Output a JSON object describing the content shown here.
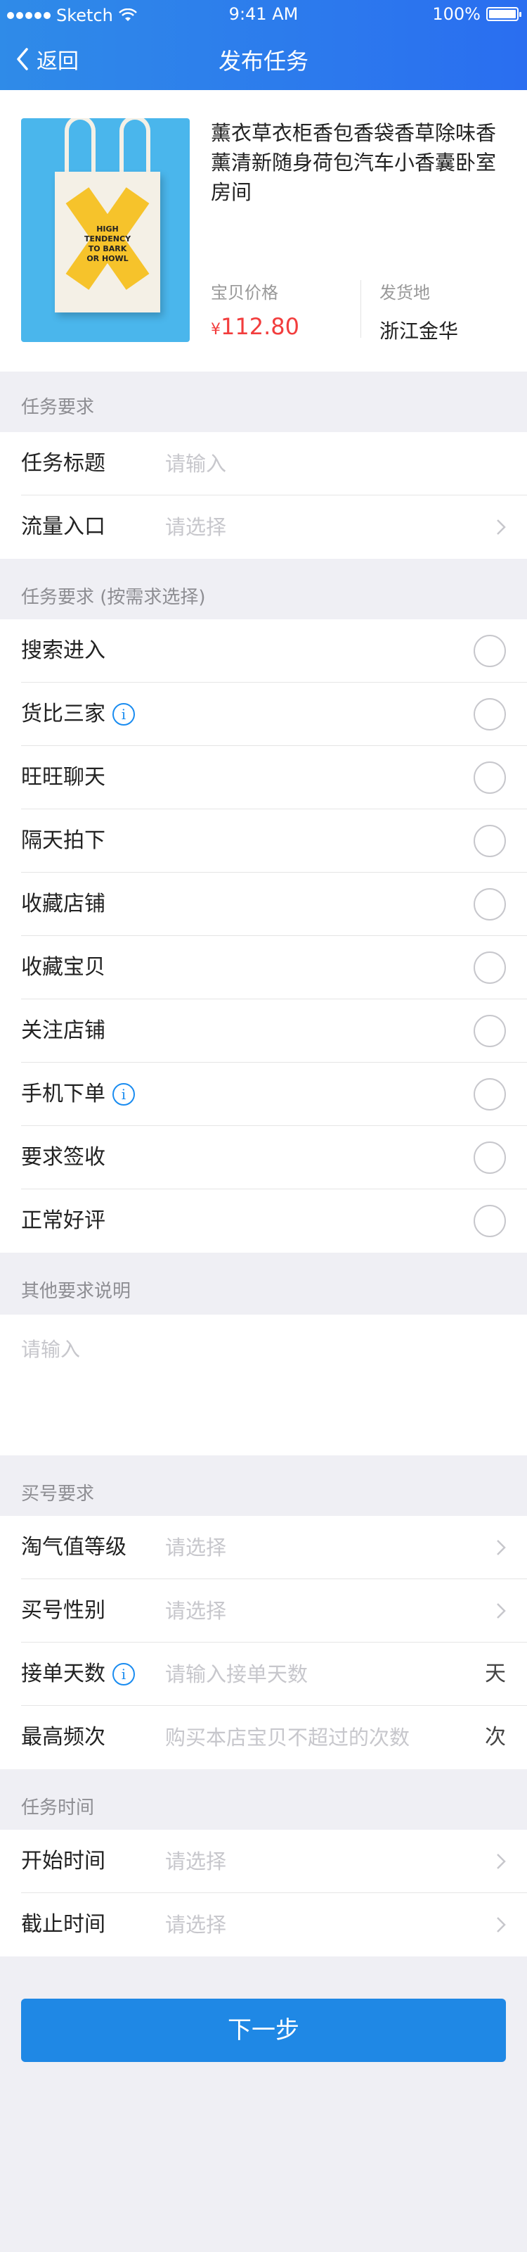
{
  "status_bar": {
    "carrier": "Sketch",
    "time": "9:41 AM",
    "battery": "100%",
    "battery_level": 1.0
  },
  "nav": {
    "back_label": "返回",
    "title": "发布任务"
  },
  "product": {
    "title": "薰衣草衣柜香包香袋香草除味香薰清新随身荷包汽车小香囊卧室房间",
    "image_text": [
      "HIGH",
      "TENDENCY",
      "TO BARK",
      "OR HOWL"
    ],
    "price_label": "宝贝价格",
    "price_currency": "¥",
    "price_value": "112.80",
    "origin_label": "发货地",
    "origin_value": "浙江金华"
  },
  "task_section": {
    "header": "任务要求",
    "rows": [
      {
        "label": "任务标题",
        "placeholder": "请输入"
      },
      {
        "label": "流量入口",
        "placeholder": "请选择"
      }
    ]
  },
  "options_section": {
    "header": "任务要求 (按需求选择)",
    "items": [
      {
        "label": "搜索进入",
        "info": false
      },
      {
        "label": "货比三家",
        "info": true
      },
      {
        "label": "旺旺聊天",
        "info": false
      },
      {
        "label": "隔天拍下",
        "info": false
      },
      {
        "label": "收藏店铺",
        "info": false
      },
      {
        "label": "收藏宝贝",
        "info": false
      },
      {
        "label": "关注店铺",
        "info": false
      },
      {
        "label": "手机下单",
        "info": true
      },
      {
        "label": "要求签收",
        "info": false
      },
      {
        "label": "正常好评",
        "info": false
      }
    ]
  },
  "other_section": {
    "header": "其他要求说明",
    "placeholder": "请输入"
  },
  "buyer_section": {
    "header": "买号要求",
    "rows": [
      {
        "label": "淘气值等级",
        "placeholder": "请选择"
      },
      {
        "label": "买号性别",
        "placeholder": "请选择"
      },
      {
        "label": "接单天数",
        "placeholder": "请输入接单天数",
        "unit": "天"
      },
      {
        "label": "最高频次",
        "placeholder": "购买本店宝贝不超过的次数",
        "unit": "次"
      }
    ]
  },
  "time_section": {
    "header": "任务时间",
    "rows": [
      {
        "label": "开始时间",
        "placeholder": "请选择"
      },
      {
        "label": "截止时间",
        "placeholder": "请选择"
      }
    ]
  },
  "next_button": "下一步",
  "icons": {
    "back": "chevron-left-icon",
    "chevron": "chevron-right-icon",
    "info": "info-icon",
    "radio": "radio-unchecked-icon",
    "wifi": "wifi-icon"
  },
  "colors": {
    "primary": "#1f88e5",
    "price": "#f23d3d",
    "placeholder": "#c7c7cc",
    "background": "#efeff4"
  }
}
